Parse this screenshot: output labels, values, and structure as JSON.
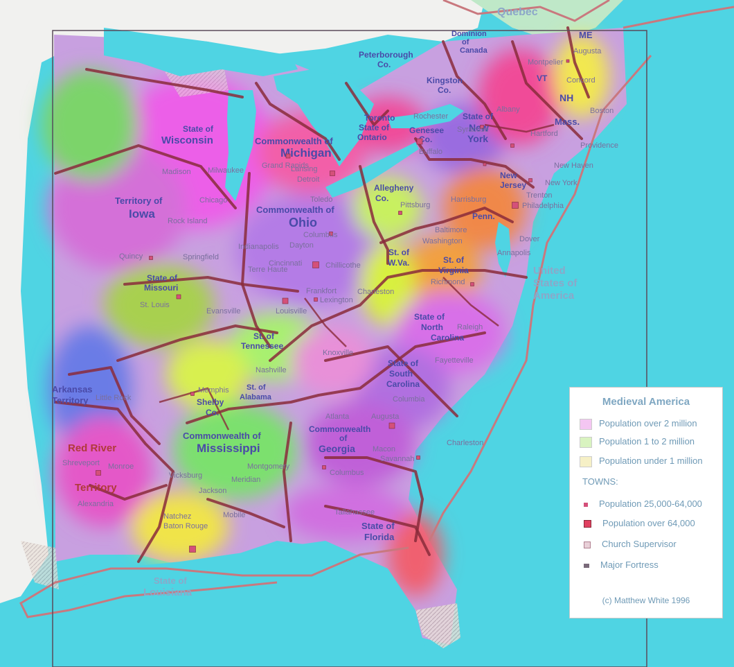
{
  "legend": {
    "title": "Medieval America",
    "population_classes": [
      {
        "label": "Population over 2 million",
        "color": "#f4c6f2"
      },
      {
        "label": "Population 1 to 2 million",
        "color": "#d9f3c0"
      },
      {
        "label": "Population under 1 million",
        "color": "#f6f0c6"
      }
    ],
    "towns_heading": "TOWNS:",
    "town_classes": [
      {
        "label": "Population 25,000-64,000",
        "marker": "small-square",
        "color": "#d4507a"
      },
      {
        "label": "Population over 64,000",
        "marker": "large-square",
        "color": "#e04060"
      },
      {
        "label": "Church Supervisor",
        "marker": "cross-square",
        "color": "#b08090"
      },
      {
        "label": "Major Fortress",
        "marker": "fortress",
        "color": "#7a6a7a"
      }
    ],
    "credit": "(c) Matthew White 1996"
  },
  "regions": {
    "quebec": "Quebec",
    "dominion": [
      "Dominion",
      "of",
      "Canada"
    ],
    "me": "ME",
    "vt": "VT",
    "nh": "NH",
    "mass": "Mass.",
    "peterborough": [
      "Peterborough",
      "Co."
    ],
    "kingston": [
      "Kingston",
      "Co."
    ],
    "ontario": [
      "Toronto",
      "State of",
      "Ontario"
    ],
    "genesee": [
      "Genesee",
      "Co."
    ],
    "newyork": [
      "State of",
      "New",
      "York"
    ],
    "wisconsin": [
      "State of",
      "Wisconsin"
    ],
    "michigan": [
      "Commonwealth of",
      "Michigan"
    ],
    "iowa": [
      "Territory of",
      "Iowa"
    ],
    "ohio": [
      "Commonwealth of",
      "Ohio"
    ],
    "allegheny": [
      "Allegheny",
      "Co."
    ],
    "newjersey": [
      "New",
      "Jersey"
    ],
    "penn": "Penn.",
    "wva": [
      "St. of",
      "W.Va."
    ],
    "virginia": [
      "St. of",
      "Virginia"
    ],
    "usa": [
      "United",
      "States of",
      "America"
    ],
    "missouri": [
      "State of",
      "Missouri"
    ],
    "tennessee": [
      "St. of",
      "Tennessee"
    ],
    "northcarolina": [
      "State of",
      "North",
      "Carolina"
    ],
    "southcarolina": [
      "State of",
      "South",
      "Carolina"
    ],
    "arkansas": [
      "Arkansas",
      "Territory"
    ],
    "shelby": [
      "Shelby",
      "Co."
    ],
    "alabama": [
      "St. of",
      "Alabama"
    ],
    "mississippi": [
      "Commonwealth of",
      "Mississippi"
    ],
    "georgia": [
      "Commonwealth",
      "of",
      "Georgia"
    ],
    "redriver": [
      "Red River",
      "Territory"
    ],
    "florida": [
      "State of",
      "Florida"
    ],
    "louisiana": [
      "State of",
      "Louisiana"
    ]
  },
  "cities": {
    "augusta_me": "Augusta",
    "montpelier": "Montpelier",
    "concord": "Concord",
    "boston": "Boston",
    "providence": "Providence",
    "hartford": "Hartford",
    "newhaven": "New Haven",
    "newyorkcity": "New York",
    "trenton": "Trenton",
    "philadelphia": "Philadelphia",
    "albany": "Albany",
    "syracuse": "Syracuse",
    "rochester": "Rochester",
    "buffalo": "Buffalo",
    "harrisburg": "Harrisburg",
    "baltimore": "Baltimore",
    "washington": "Washington",
    "dover": "Dover",
    "annapolis": "Annapolis",
    "richmond": "Richmond",
    "pittsburg": "Pittsburg",
    "charleston_wv": "Charleston",
    "raleigh": "Raleigh",
    "fayetteville": "Fayetteville",
    "columbia": "Columbia",
    "charleston_sc": "Charleston",
    "augusta_ga": "Augusta",
    "atlanta": "Atlanta",
    "macon": "Macon",
    "savannah": "Savannah",
    "columbus_ga": "Columbus",
    "tallahassee": "Tallahassee",
    "montgomery": "Montgomery",
    "mobile": "Mobile",
    "meridian": "Meridian",
    "jackson": "Jackson",
    "vicksburg": "Vicksburg",
    "natchez": "Natchez",
    "batonrouge": "Baton Rouge",
    "alexandria": "Alexandria",
    "shreveport": "Shreveport",
    "monroe": "Monroe",
    "littlerock": "Little Rock",
    "memphis": "Memphis",
    "nashville": "Nashville",
    "knoxville": "Knoxville",
    "louisville": "Louisville",
    "frankfort": "Frankfort",
    "lexington": "Lexington",
    "evansville": "Evansville",
    "stlouis": "St. Louis",
    "springfield": "Springfield",
    "quincy": "Quincy",
    "terrehaute": "Terre Haute",
    "indianapolis": "Indianapolis",
    "dayton": "Dayton",
    "columbus_oh": "Columbus",
    "cincinnati": "Cincinnati",
    "chillicothe": "Chillicothe",
    "toledo": "Toledo",
    "detroit": "Detroit",
    "lansing": "Lansing",
    "grandrapids": "Grand Rapids",
    "chicago": "Chicago",
    "milwaukee": "Milwaukee",
    "madison": "Madison",
    "rockisland": "Rock Island"
  }
}
